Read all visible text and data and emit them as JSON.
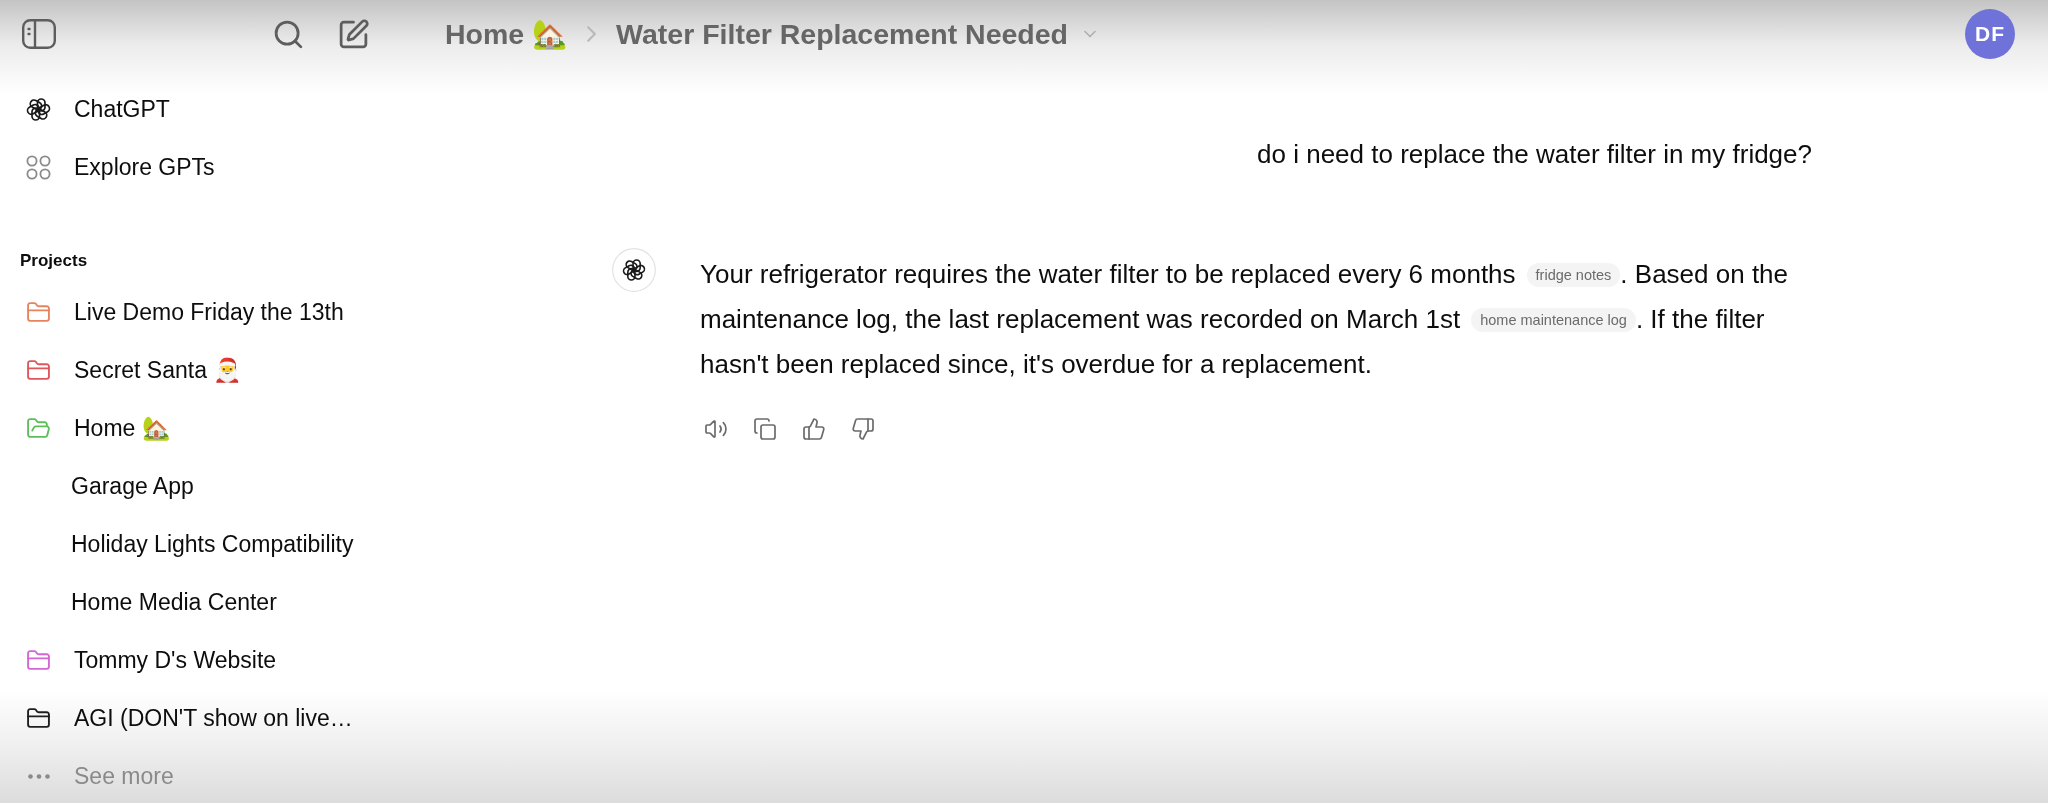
{
  "sidebar": {
    "nav": [
      {
        "kind": "logo",
        "label": "ChatGPT"
      },
      {
        "kind": "grid",
        "label": "Explore GPTs"
      }
    ],
    "projects": {
      "title": "Projects",
      "items": [
        {
          "label": "Live Demo Friday the 13th",
          "color": "#e8845c",
          "expanded": false
        },
        {
          "label": "Secret Santa 🎅",
          "color": "#e0575b",
          "expanded": false
        },
        {
          "label": "Home 🏡",
          "color": "#5cbf5c",
          "expanded": true,
          "children": [
            {
              "label": "Garage App"
            },
            {
              "label": "Holiday Lights Compatibility"
            },
            {
              "label": "Home Media Center"
            }
          ]
        },
        {
          "label": "Tommy D's Website",
          "color": "#d566d6",
          "expanded": false
        },
        {
          "label": "AGI (DON'T show on live…",
          "color": "#1f1f1f",
          "expanded": false
        }
      ],
      "see_more": "See more"
    }
  },
  "header": {
    "breadcrumb": [
      "Home 🏡",
      "Water Filter Replacement Needed"
    ],
    "avatar_initials": "DF"
  },
  "conversation": [
    {
      "kind": "user",
      "text": "do i need to replace the water filter in my fridge?"
    },
    {
      "kind": "assistant",
      "parts": [
        {
          "kind": "text",
          "text": "Your refrigerator requires the water filter to be replaced every 6 months"
        },
        {
          "kind": "citation",
          "text": "fridge notes"
        },
        {
          "kind": "text",
          "text": ". Based on the maintenance log, the last replacement was recorded on March 1st"
        },
        {
          "kind": "citation",
          "text": "home maintenance log"
        },
        {
          "kind": "text",
          "text": ". If the filter hasn't been replaced since, it's overdue for a replacement."
        }
      ]
    }
  ]
}
